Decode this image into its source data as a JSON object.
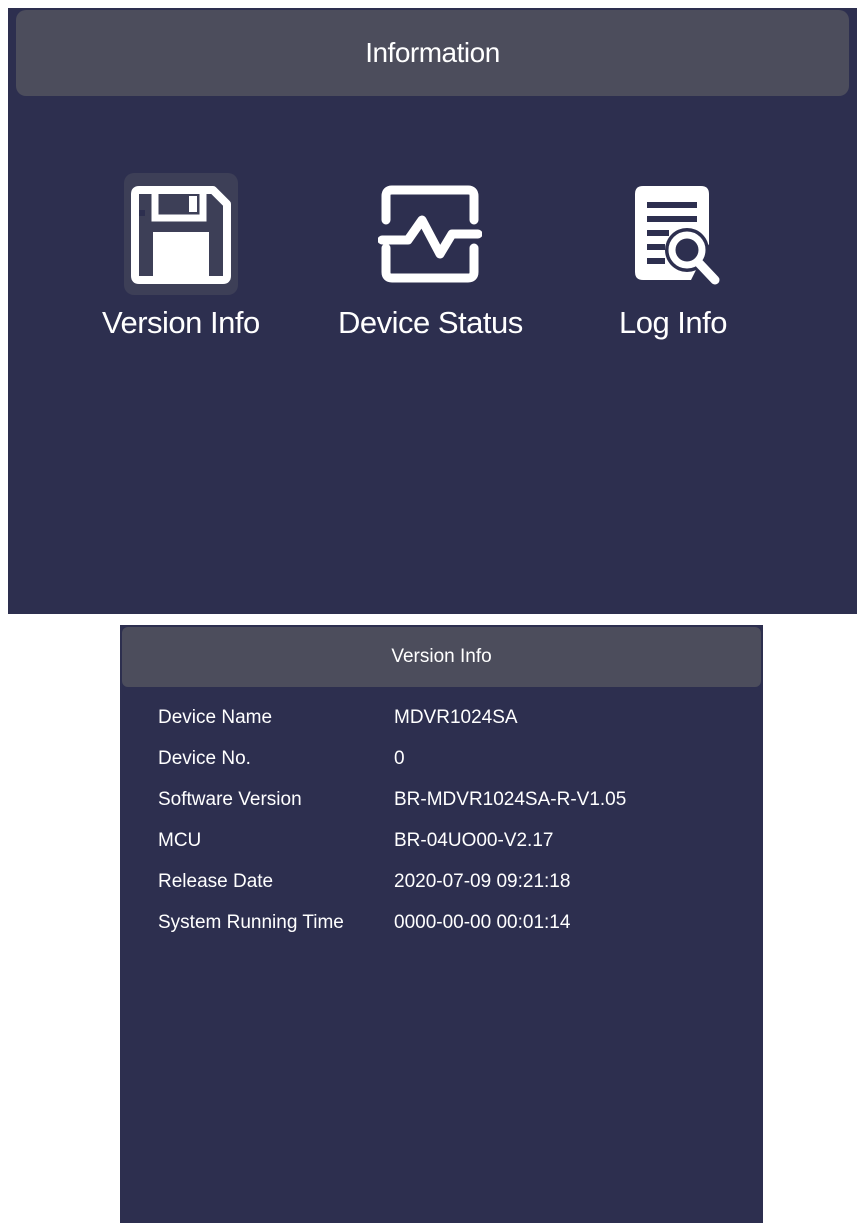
{
  "information": {
    "title": "Information",
    "items": [
      {
        "label": "Version Info",
        "icon": "floppy-disk-icon",
        "selected": true
      },
      {
        "label": "Device Status",
        "icon": "pulse-monitor-icon",
        "selected": false
      },
      {
        "label": "Log Info",
        "icon": "document-search-icon",
        "selected": false
      }
    ]
  },
  "version_info": {
    "title": "Version Info",
    "rows": [
      {
        "key": "Device Name",
        "value": "MDVR1024SA"
      },
      {
        "key": "Device No.",
        "value": "0"
      },
      {
        "key": "Software Version",
        "value": "BR-MDVR1024SA-R-V1.05"
      },
      {
        "key": "MCU",
        "value": "BR-04UO00-V2.17"
      },
      {
        "key": "Release Date",
        "value": "2020-07-09 09:21:18"
      },
      {
        "key": "System Running Time",
        "value": "0000-00-00 00:01:14"
      }
    ]
  },
  "colors": {
    "panel_bg": "#2d2f4f",
    "header_bg": "#4c4d5c",
    "text": "#ffffff"
  }
}
